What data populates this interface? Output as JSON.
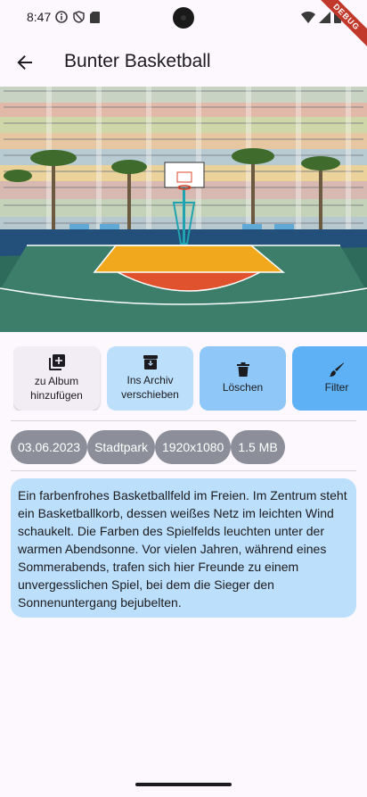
{
  "status": {
    "time": "8:47",
    "debug_label": "DEBUG"
  },
  "header": {
    "title": "Bunter Basketball"
  },
  "actions": [
    {
      "label": "zu Album hinzufügen",
      "icon": "add-to-album-icon"
    },
    {
      "label": "Ins Archiv verschieben",
      "icon": "archive-icon"
    },
    {
      "label": "Löschen",
      "icon": "trash-icon"
    },
    {
      "label": "Filter",
      "icon": "brush-icon"
    }
  ],
  "metadata_chips": [
    "03.06.2023",
    "Stadtpark",
    "1920x1080",
    "1.5 MB"
  ],
  "description": "Ein farbenfrohes Basketballfeld im Freien. Im Zentrum steht ein Basketballkorb, dessen weißes Netz im leichten Wind schaukelt. Die Farben des Spielfelds leuchten unter der warmen Abendsonne. Vor vielen Jahren, während eines Sommerabends, trafen sich hier Freunde zu einem unvergesslichen Spiel, bei dem die Sieger den Sonnenuntergang bejubelten.",
  "colors": {
    "background": "#fdf7fe",
    "chip": "#8c8f99",
    "card": "#bcdffb",
    "archive_button": "#bcdffb",
    "delete_button": "#8fc8f8",
    "filter_button": "#5eb1f4"
  }
}
